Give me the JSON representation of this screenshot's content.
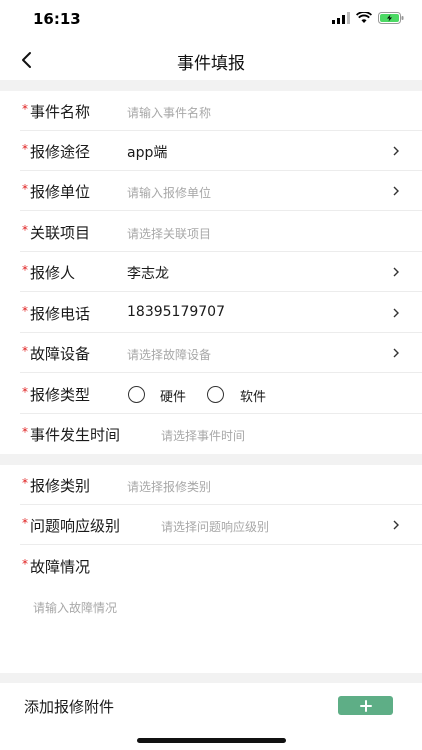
{
  "status_bar": {
    "time": "16:13"
  },
  "nav": {
    "title": "事件填报"
  },
  "required_mark": "*",
  "form": {
    "event_name": {
      "label": "事件名称",
      "placeholder": "请输入事件名称"
    },
    "repair_channel": {
      "label": "报修途径",
      "value": "app端"
    },
    "repair_unit": {
      "label": "报修单位",
      "placeholder": "请输入报修单位"
    },
    "related_project": {
      "label": "关联项目",
      "placeholder": "请选择关联项目"
    },
    "reporter": {
      "label": "报修人",
      "value": "李志龙"
    },
    "phone": {
      "label": "报修电话",
      "value": "18395179707"
    },
    "device": {
      "label": "故障设备",
      "placeholder": "请选择故障设备"
    },
    "repair_type": {
      "label": "报修类型",
      "options": [
        "硬件",
        "软件"
      ]
    },
    "event_time": {
      "label": "事件发生时间",
      "placeholder": "请选择事件时间"
    },
    "repair_category": {
      "label": "报修类别",
      "placeholder": "请选择报修类别"
    },
    "response_level": {
      "label": "问题响应级别",
      "placeholder": "请选择问题响应级别"
    },
    "fault_desc": {
      "label": "故障情况",
      "placeholder": "请输入故障情况"
    }
  },
  "attachment": {
    "label": "添加报修附件",
    "add_icon": "plus-icon"
  },
  "colors": {
    "accent": "#5eae86",
    "required": "#e02020",
    "placeholder": "#a8a8a8",
    "divider": "#f2f2f2"
  }
}
